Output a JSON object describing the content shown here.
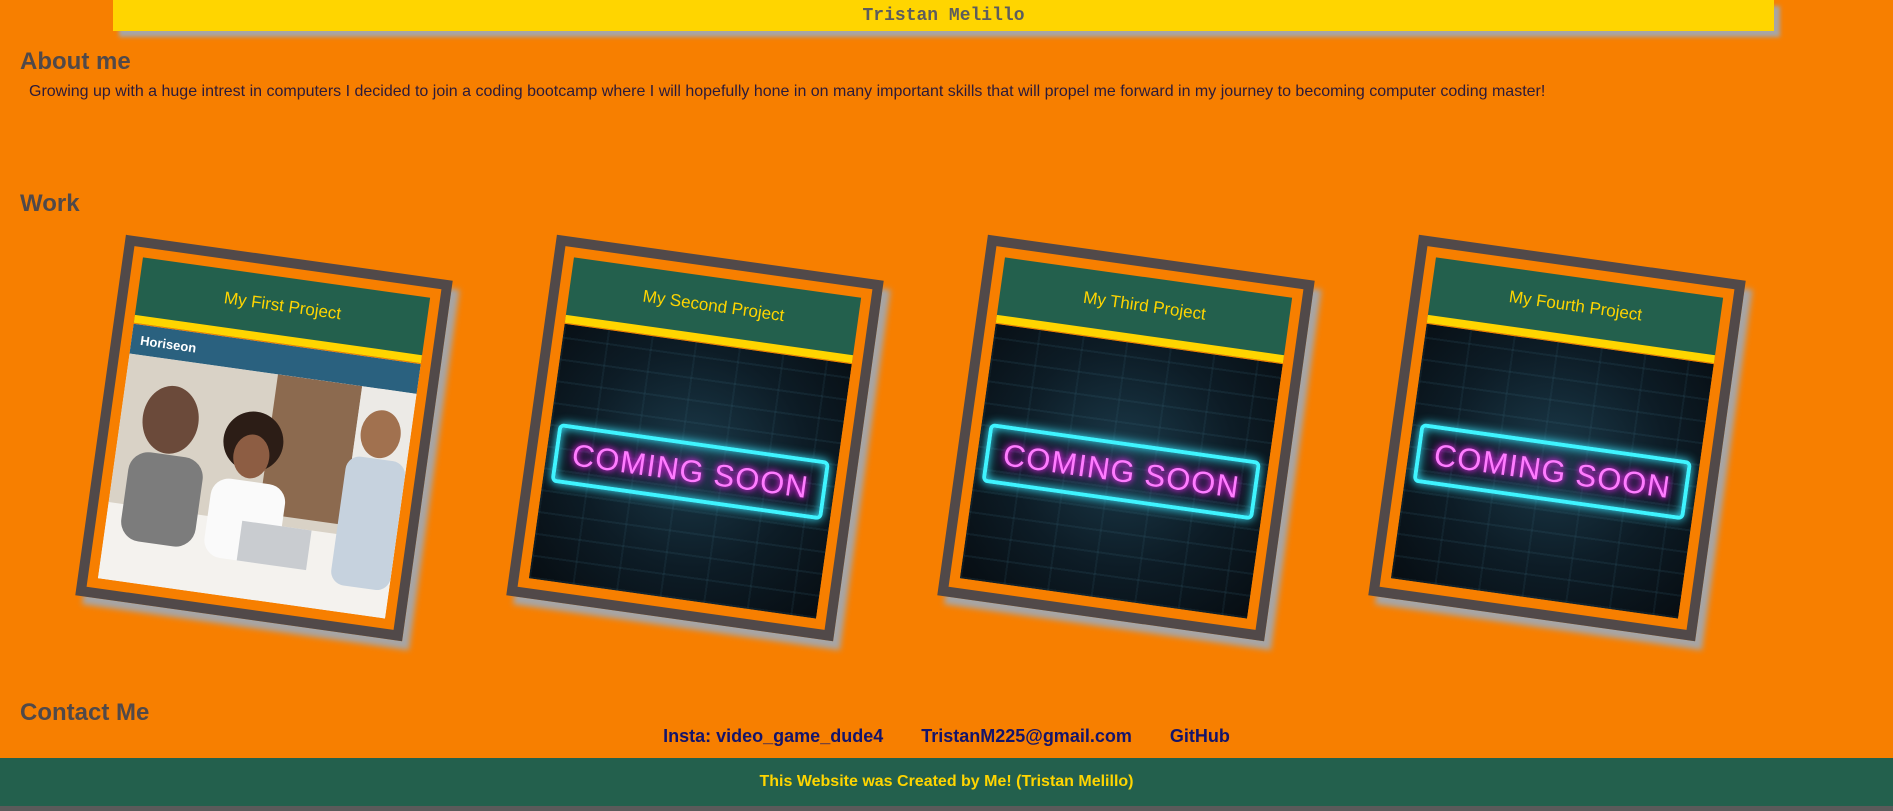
{
  "header": {
    "name": "Tristan Melillo"
  },
  "about": {
    "heading": "About me",
    "text": "Growing up with a huge intrest in computers I decided to join a coding bootcamp where I will hopefully hone in on many important skills that will propel me forward in my journey to becoming computer coding master!"
  },
  "work": {
    "heading": "Work",
    "projects": [
      {
        "title": "My First Project",
        "image": "Horiseon",
        "brand": "Horiseon"
      },
      {
        "title": "My Second Project",
        "image": "Coming Soon",
        "sign_text": "COMING SOON"
      },
      {
        "title": "My Third Project",
        "image": "Coming Soon",
        "sign_text": "COMING SOON"
      },
      {
        "title": "My Fourth Project",
        "image": "Coming Soon",
        "sign_text": "COMING SOON"
      }
    ]
  },
  "contact": {
    "heading": "Contact Me",
    "links": [
      {
        "label": "Insta: video_game_dude4"
      },
      {
        "label": "TristanM225@gmail.com"
      },
      {
        "label": "GitHub"
      }
    ]
  },
  "footer": {
    "text": "This Website was Created by Me! (Tristan Melillo)"
  },
  "colors": {
    "page_bg": "#f77f00",
    "header_bg": "#ffd500",
    "accent_green": "#23604d",
    "card_border": "#514949",
    "link_color": "#14146b"
  }
}
